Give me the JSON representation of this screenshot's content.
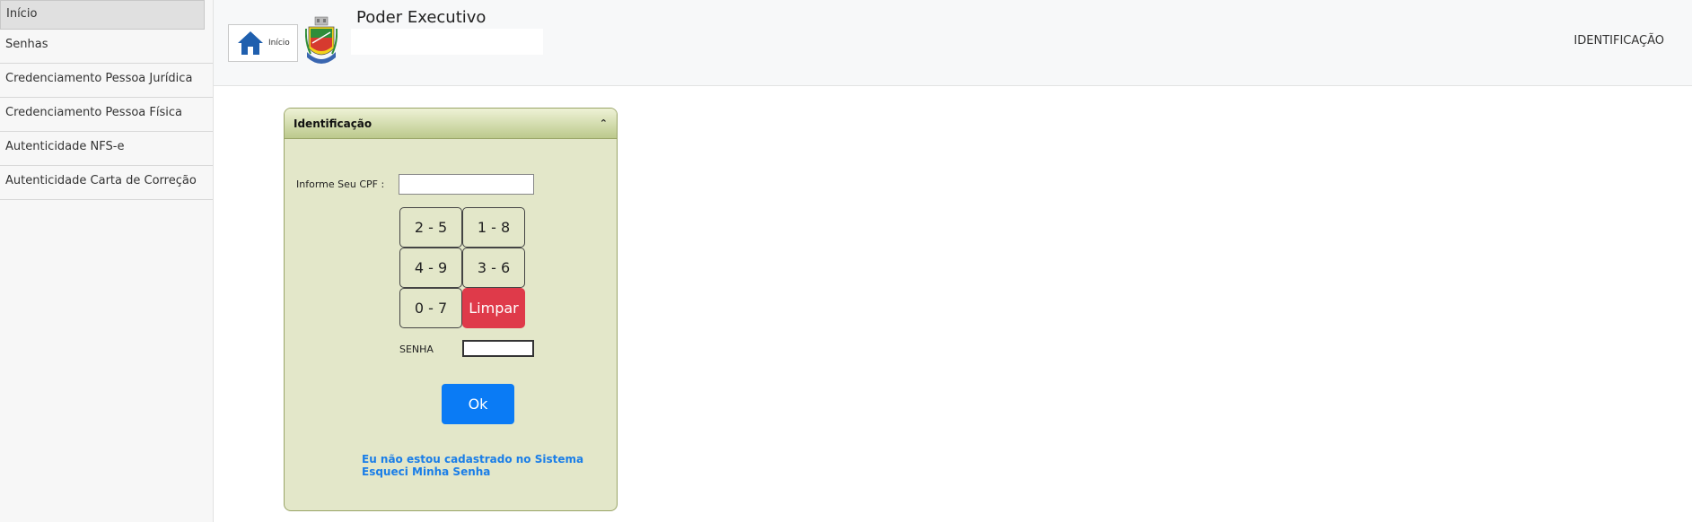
{
  "sidebar": {
    "items": [
      {
        "label": "Início"
      },
      {
        "label": "Senhas"
      },
      {
        "label": "Credenciamento Pessoa Jurídica"
      },
      {
        "label": "Credenciamento Pessoa Física"
      },
      {
        "label": "Autenticidade NFS-e"
      },
      {
        "label": "Autenticidade Carta de Correção"
      }
    ]
  },
  "header": {
    "home_label": "Início",
    "title": "Poder Executivo",
    "identificacao": "IDENTIFICAÇÃO",
    "home_icon": "home-icon",
    "crest_icon": "coat-of-arms"
  },
  "panel": {
    "title": "Identificação",
    "cpf_label": "Informe Seu CPF :",
    "cpf_value": "",
    "keys": [
      "2 - 5",
      "1 - 8",
      "4 - 9",
      "3 - 6",
      "0 - 7"
    ],
    "clear_label": "Limpar",
    "senha_label": "SENHA",
    "senha_value": "",
    "ok_label": "Ok",
    "link_not_registered": "Eu não estou cadastrado no Sistema",
    "link_forgot": "Esqueci Minha Senha"
  },
  "colors": {
    "panel_bg": "#e3e7c9",
    "panel_border": "#9aa568",
    "clear_button": "#df3a4a",
    "ok_button": "#0a7bf5",
    "link": "#1a7ee8",
    "home_icon": "#1f5fae"
  }
}
